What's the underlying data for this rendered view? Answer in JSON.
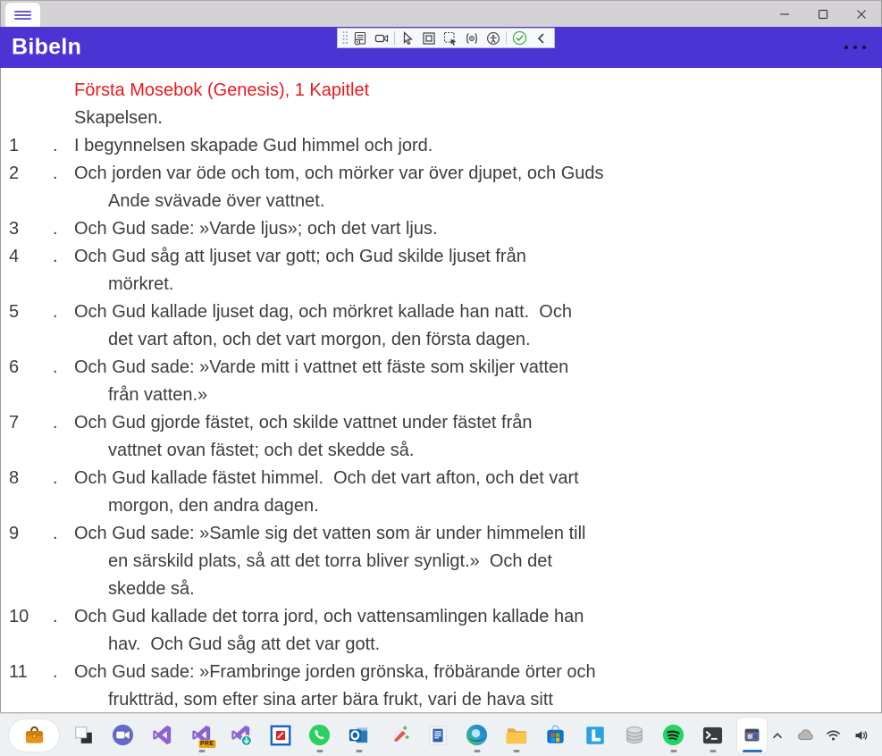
{
  "window": {
    "controls": [
      {
        "name": "minimize"
      },
      {
        "name": "maximize"
      },
      {
        "name": "close"
      }
    ]
  },
  "header": {
    "app_title": "Bibeln"
  },
  "debug_toolbar": {
    "icons": [
      "drag-handle",
      "live-visual-tree",
      "screencast",
      "select-element",
      "layout-adorners",
      "track-focused-element",
      "hot-reload",
      "accessibility-checker",
      "status-check",
      "collapse-chevron"
    ]
  },
  "content": {
    "chapter_heading": "Första Mosebok (Genesis), 1 Kapitlet",
    "section_title": "Skapelsen.",
    "verse_separator": ".",
    "verses": [
      {
        "num": "1",
        "text": "I begynnelsen skapade Gud himmel och jord."
      },
      {
        "num": "2",
        "text": "Och jorden var öde och tom, och mörker var över djupet, och Guds\nAnde svävade över vattnet."
      },
      {
        "num": "3",
        "text": "Och Gud sade: »Varde ljus»; och det vart ljus."
      },
      {
        "num": "4",
        "text": "Och Gud såg att ljuset var gott; och Gud skilde ljuset från\nmörkret."
      },
      {
        "num": "5",
        "text": "Och Gud kallade ljuset dag, och mörkret kallade han natt.  Och\ndet vart afton, och det vart morgon, den första dagen."
      },
      {
        "num": "6",
        "text": "Och Gud sade: »Varde mitt i vattnet ett fäste som skiljer vatten\nfrån vatten.»"
      },
      {
        "num": "7",
        "text": "Och Gud gjorde fästet, och skilde vattnet under fästet från\nvattnet ovan fästet; och det skedde så."
      },
      {
        "num": "8",
        "text": "Och Gud kallade fästet himmel.  Och det vart afton, och det vart\nmorgon, den andra dagen."
      },
      {
        "num": "9",
        "text": "Och Gud sade: »Samle sig det vatten som är under himmelen till\nen särskild plats, så att det torra bliver synligt.»  Och det\nskedde så."
      },
      {
        "num": "10",
        "text": "Och Gud kallade det torra jord, och vattensamlingen kallade han\nhav.  Och Gud såg att det var gott."
      },
      {
        "num": "11",
        "text": "Och Gud sade: »Frambringe jorden grönska, fröbärande örter och\nfruktträd, som efter sina arter bära frukt, vari de hava sitt"
      }
    ]
  },
  "taskbar": {
    "apps": [
      {
        "name": "launcher-briefcase",
        "icon": "briefcase",
        "pill": true
      },
      {
        "name": "desktops",
        "icon": "desktops"
      },
      {
        "name": "video-chat",
        "icon": "videochat"
      },
      {
        "name": "visual-studio",
        "icon": "vs"
      },
      {
        "name": "visual-studio-preview",
        "icon": "vs",
        "badge": "PRE",
        "running": true
      },
      {
        "name": "visual-studio-installer",
        "icon": "vsinstaller"
      },
      {
        "name": "red-tile-app",
        "icon": "redtile"
      },
      {
        "name": "whatsapp",
        "icon": "whatsapp",
        "running": true
      },
      {
        "name": "outlook",
        "icon": "outlook",
        "running": true
      },
      {
        "name": "eraser-3d",
        "icon": "eraser"
      },
      {
        "name": "blue-document",
        "icon": "bluedoc"
      },
      {
        "name": "edge",
        "icon": "edge",
        "running": true
      },
      {
        "name": "file-explorer",
        "icon": "folder",
        "running": true
      },
      {
        "name": "microsoft-store",
        "icon": "store"
      },
      {
        "name": "linqpad",
        "icon": "linqpad"
      },
      {
        "name": "database-tool",
        "icon": "database"
      },
      {
        "name": "spotify",
        "icon": "spotify",
        "running": true
      },
      {
        "name": "terminal",
        "icon": "terminal",
        "running": true
      },
      {
        "name": "bibeln",
        "icon": "bibeln",
        "active": true
      }
    ],
    "tray": [
      "tray-chevron-up",
      "onedrive-cloud",
      "wifi",
      "volume"
    ]
  },
  "colors": {
    "accent_purple": "#4c33d4",
    "heading_red": "#e8191f",
    "active_indicator_blue": "#2170cd"
  }
}
